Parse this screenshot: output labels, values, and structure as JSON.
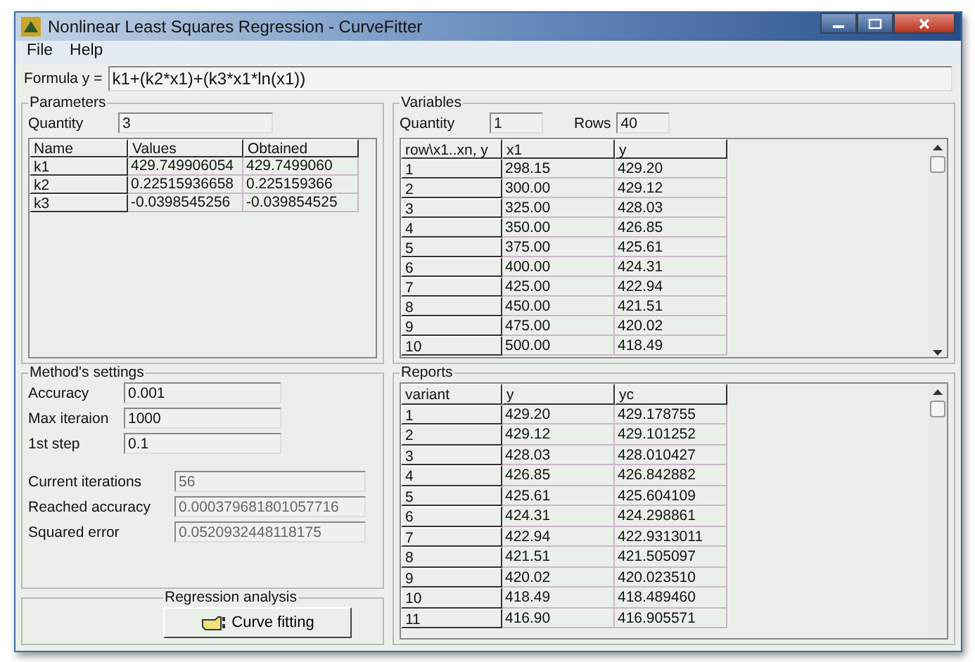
{
  "window": {
    "title": "Nonlinear Least Squares Regression - CurveFitter"
  },
  "menu": [
    "File",
    "Help"
  ],
  "formula": {
    "label": "Formula  y =",
    "value": "k1+(k2*x1)+(k3*x1*ln(x1))"
  },
  "parameters": {
    "title": "Parameters",
    "quantity_label": "Quantity",
    "quantity": "3",
    "columns": [
      "Name",
      "Values",
      "Obtained"
    ],
    "rows": [
      [
        "k1",
        "429.749906054",
        "429.7499060"
      ],
      [
        "k2",
        "0.22515936658",
        "0.225159366"
      ],
      [
        "k3",
        "-0.0398545256",
        "-0.039854525"
      ]
    ]
  },
  "variables": {
    "title": "Variables",
    "quantity_label": "Quantity",
    "quantity": "1",
    "rows_label": "Rows",
    "rows_count": "40",
    "columns": [
      "row\\x1..xn, y",
      "x1",
      "y"
    ],
    "rows": [
      [
        "1",
        "298.15",
        "429.20"
      ],
      [
        "2",
        "300.00",
        "429.12"
      ],
      [
        "3",
        "325.00",
        "428.03"
      ],
      [
        "4",
        "350.00",
        "426.85"
      ],
      [
        "5",
        "375.00",
        "425.61"
      ],
      [
        "6",
        "400.00",
        "424.31"
      ],
      [
        "7",
        "425.00",
        "422.94"
      ],
      [
        "8",
        "450.00",
        "421.51"
      ],
      [
        "9",
        "475.00",
        "420.02"
      ],
      [
        "10",
        "500.00",
        "418.49"
      ]
    ]
  },
  "settings": {
    "title": "Method's settings",
    "inputs": [
      {
        "label": "Accuracy",
        "value": "0.001"
      },
      {
        "label": "Max iteraion",
        "value": "1000"
      },
      {
        "label": "1st step",
        "value": "0.1"
      }
    ],
    "results": [
      {
        "label": "Current iterations",
        "value": "56"
      },
      {
        "label": "Reached accuracy",
        "value": "0.000379681801057716"
      },
      {
        "label": "Squared error",
        "value": "0.0520932448118175"
      }
    ]
  },
  "regression": {
    "title": "Regression analysis",
    "button": "Curve fitting"
  },
  "reports": {
    "title": "Reports",
    "columns": [
      "variant",
      "y",
      "yc"
    ],
    "rows": [
      [
        "1",
        "429.20",
        "429.178755"
      ],
      [
        "2",
        "429.12",
        "429.101252"
      ],
      [
        "3",
        "428.03",
        "428.010427"
      ],
      [
        "4",
        "426.85",
        "426.842882"
      ],
      [
        "5",
        "425.61",
        "425.604109"
      ],
      [
        "6",
        "424.31",
        "424.298861"
      ],
      [
        "7",
        "422.94",
        "422.9313011"
      ],
      [
        "8",
        "421.51",
        "421.505097"
      ],
      [
        "9",
        "420.02",
        "420.023510"
      ],
      [
        "10",
        "418.49",
        "418.489460"
      ],
      [
        "11",
        "416.90",
        "416.905571"
      ]
    ]
  }
}
